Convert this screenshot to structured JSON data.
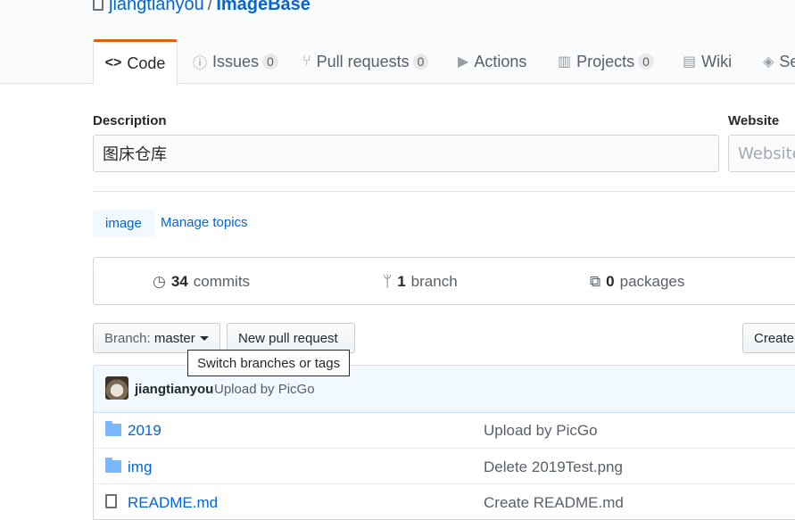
{
  "repo": {
    "owner": "jiangtianyou",
    "separator": "/",
    "name": "ImageBase"
  },
  "tabs": [
    {
      "label": "Code",
      "icon": "code-icon",
      "selected": true
    },
    {
      "label": "Issues",
      "icon": "issue-icon",
      "count": "0"
    },
    {
      "label": "Pull requests",
      "icon": "pull-request-icon",
      "count": "0"
    },
    {
      "label": "Actions",
      "icon": "play-icon"
    },
    {
      "label": "Projects",
      "icon": "project-icon",
      "count": "0"
    },
    {
      "label": "Wiki",
      "icon": "book-icon"
    },
    {
      "label": "Se",
      "icon": "shield-icon"
    }
  ],
  "about": {
    "description_label": "Description",
    "description_value": "图床仓库",
    "website_label": "Website",
    "website_placeholder": "Website"
  },
  "topics": {
    "items": [
      "image"
    ],
    "manage_label": "Manage topics"
  },
  "summary": {
    "commits": {
      "count": "34",
      "label": "commits"
    },
    "branches": {
      "count": "1",
      "label": "branch"
    },
    "packages": {
      "count": "0",
      "label": "packages"
    }
  },
  "actions": {
    "branch_prefix": "Branch:",
    "branch_name": "master",
    "new_pr": "New pull request",
    "create": "Create",
    "tooltip": "Switch branches or tags"
  },
  "latest_commit": {
    "user": "jiangtianyou",
    "message": "Upload by PicGo"
  },
  "files": [
    {
      "name": "2019",
      "type": "folder",
      "message": "Upload by PicGo"
    },
    {
      "name": "img",
      "type": "folder",
      "message": "Delete 2019Test.png"
    },
    {
      "name": "README.md",
      "type": "file",
      "message": "Create README.md"
    }
  ],
  "colors": {
    "link": "#0366d6",
    "accent": "#e36209",
    "commit_bg": "#f1f8ff"
  }
}
